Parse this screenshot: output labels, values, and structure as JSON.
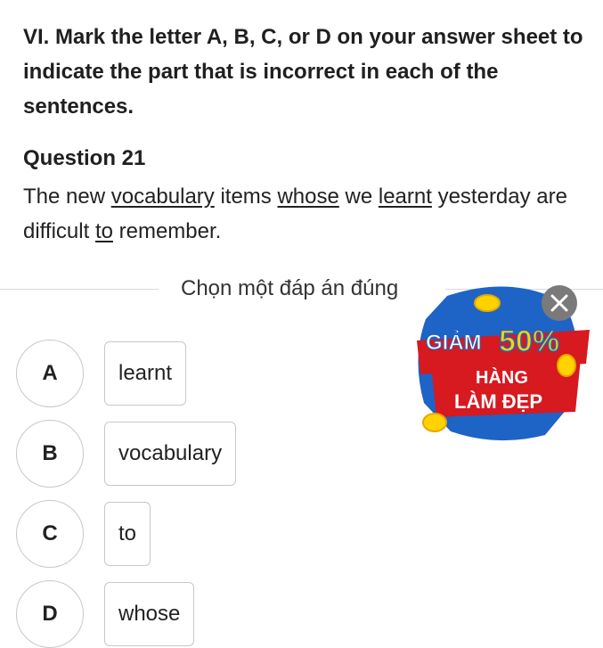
{
  "section": {
    "instruction": "VI. Mark the letter A, B, C, or D on your answer sheet to indicate the part that is incorrect in each of the sentences."
  },
  "question": {
    "title": "Question 21",
    "parts": [
      "The new ",
      "vocabulary",
      " items ",
      "whose",
      " we ",
      "learnt",
      " yesterday are difficult ",
      "to",
      " remember."
    ]
  },
  "prompt": "Chọn một đáp án đúng",
  "options": [
    {
      "letter": "A",
      "text": "learnt"
    },
    {
      "letter": "B",
      "text": "vocabulary"
    },
    {
      "letter": "C",
      "text": "to"
    },
    {
      "letter": "D",
      "text": "whose"
    }
  ],
  "ad": {
    "line1": "GIẢM",
    "line2": "50%",
    "line3": "HÀNG",
    "line4": "LÀM ĐẸP",
    "colors": {
      "red": "#d71920",
      "yellow": "#ffd200",
      "blue": "#1e63c6",
      "white": "#ffffff"
    }
  },
  "icons": {
    "close": "close-icon"
  }
}
